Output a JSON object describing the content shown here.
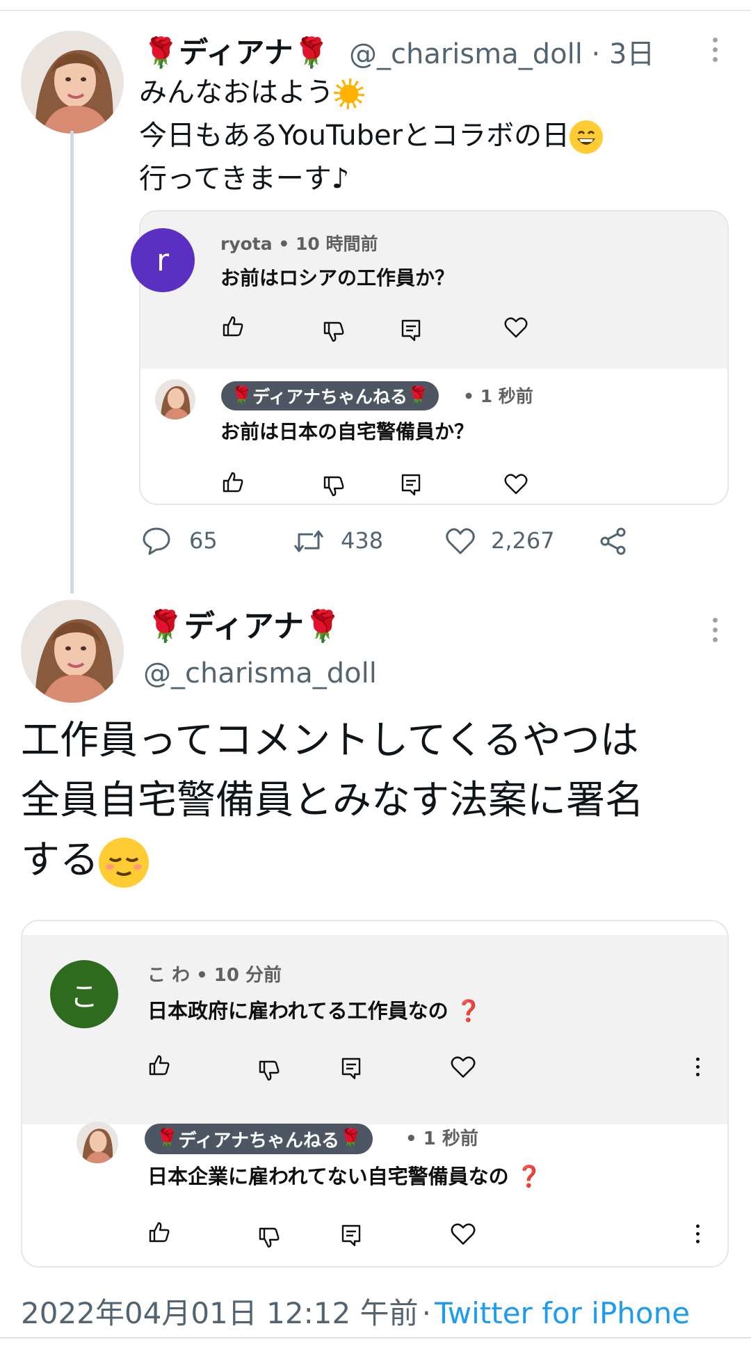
{
  "tweet1": {
    "display_name": "ディアナ",
    "handle": "@_charisma_doll",
    "time": "3日",
    "separator": "·",
    "lines": [
      "みんなおはよう",
      "今日もあるYouTuberとコラボの日",
      "行ってきまーす♪"
    ],
    "quote_card": {
      "comment": {
        "avatar_letter": "r",
        "author": "ryota",
        "time": "10 時間前",
        "text": "お前はロシアの工作員か？"
      },
      "reply": {
        "author": "ディアナちゃんねる",
        "time": "1 秒前",
        "text": "お前は日本の自宅警備員か？"
      }
    },
    "stats": {
      "replies": "65",
      "retweets": "438",
      "likes": "2,267"
    }
  },
  "tweet2": {
    "display_name": "ディアナ",
    "handle": "@_charisma_doll",
    "lines": [
      "工作員ってコメントしてくるやつは",
      "全員自宅警備員とみなす法案に署名",
      "する"
    ],
    "quote_card": {
      "comment": {
        "avatar_letter": "こ",
        "author": "こ わ",
        "time": "10 分前",
        "text": "日本政府に雇われてる工作員なの"
      },
      "reply": {
        "author": "ディアナちゃんねる",
        "time": "1 秒前",
        "text": "日本企業に雇われてない自宅警備員なの"
      }
    },
    "footer": {
      "timestamp": "2022年04月01日 12:12 午前",
      "separator": "·",
      "source": "Twitter for iPhone"
    }
  },
  "icons": {
    "rose": "rose-emoji-icon",
    "sun": "sun-emoji-icon",
    "grin": "grinning-emoji-icon",
    "relieved": "relieved-emoji-icon",
    "question": "red-question-mark-icon"
  },
  "colors": {
    "accent": "#1d9bf0",
    "ryota_avatar": "#5b2fc1",
    "kowa_avatar": "#2e6b1f",
    "chip": "#4f5663"
  }
}
